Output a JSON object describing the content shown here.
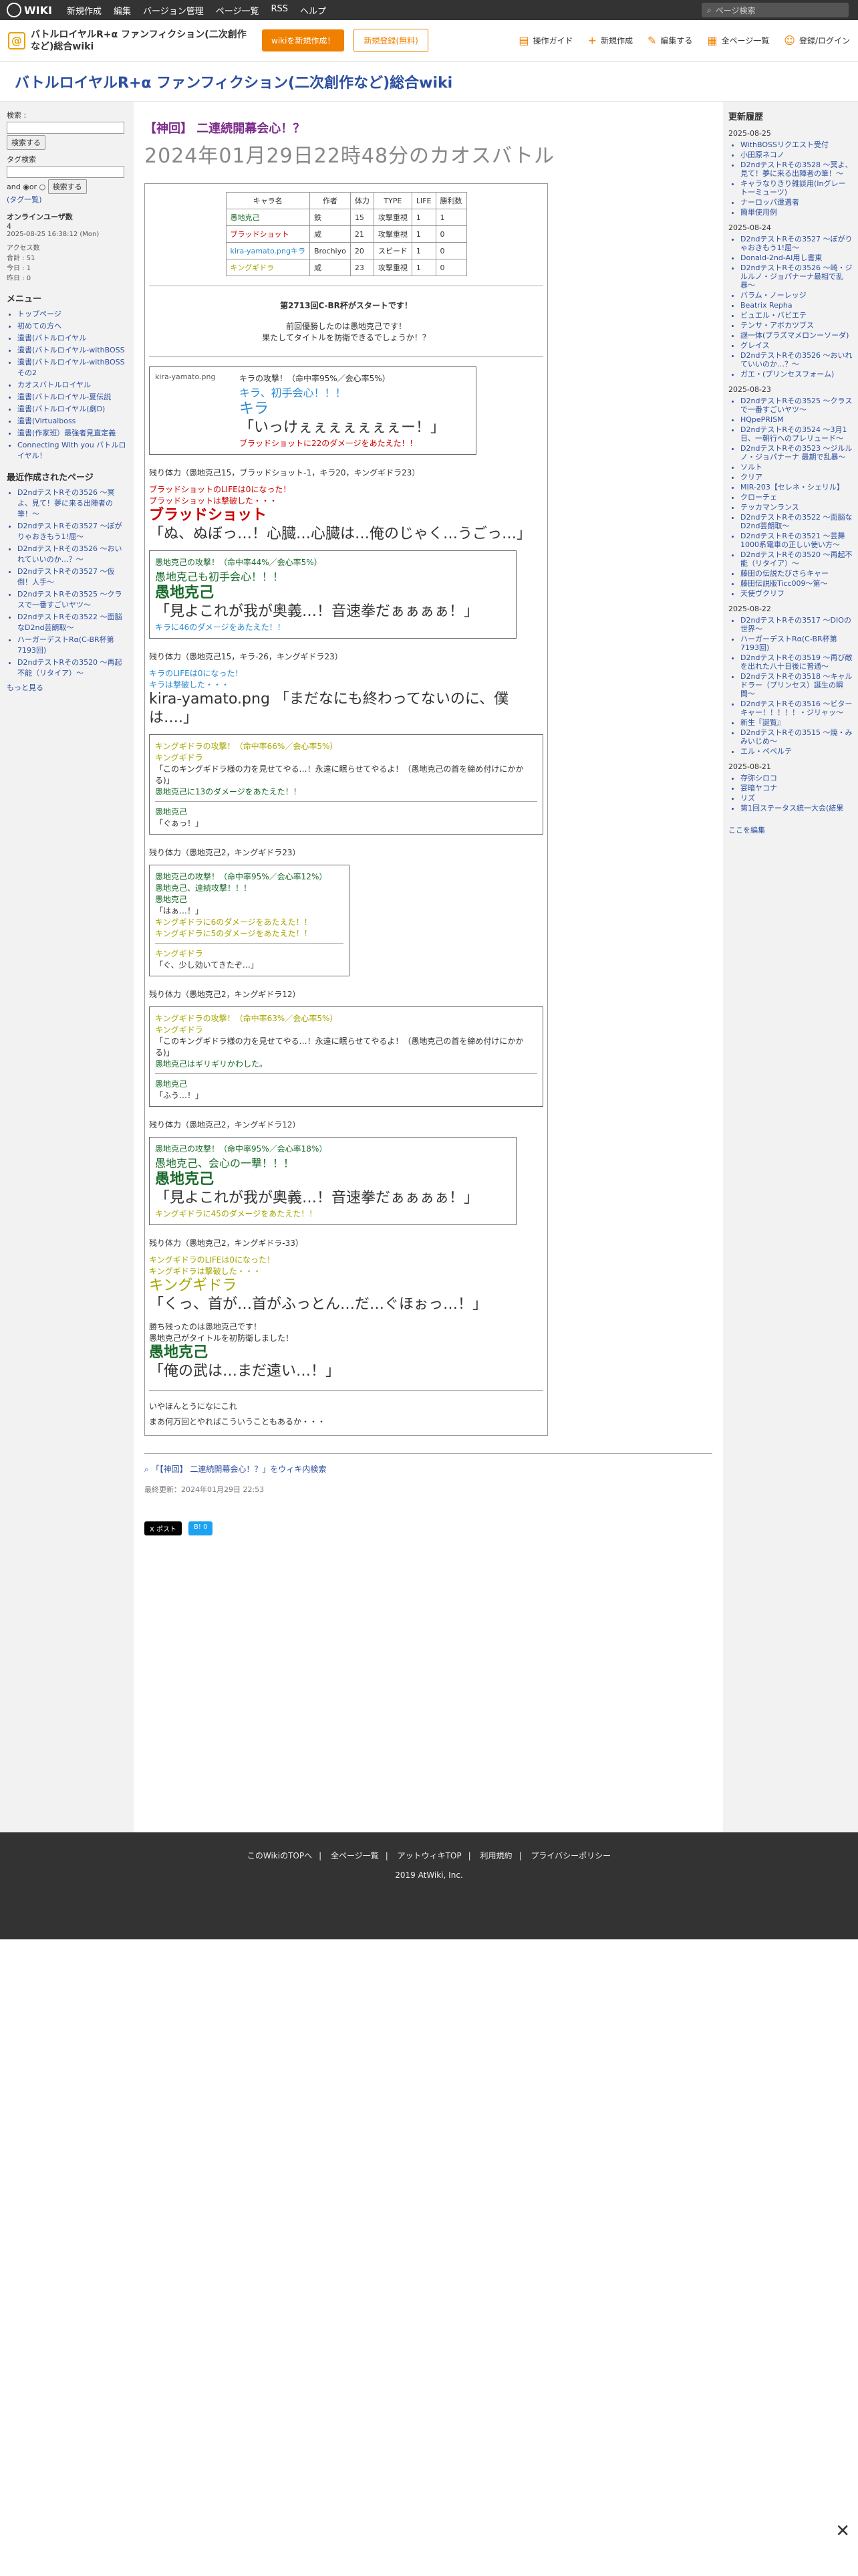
{
  "topbar": {
    "logo": "WIKI",
    "menu": [
      "新規作成",
      "編集",
      "バージョン管理",
      "ページ一覧",
      "RSS",
      "ヘルプ"
    ],
    "search_placeholder": "ページ検索"
  },
  "site": {
    "title_l1": "バトルロイヤルR+α ファンフィクション(二次創作",
    "title_l2": "など)総合wiki",
    "btn_new": "wikiを新規作成！",
    "btn_news": "新規登録(無料)",
    "tools": [
      "操作ガイド",
      "新規作成",
      "編集する",
      "全ページ一覧",
      "登録/ログイン"
    ]
  },
  "wiki_title": "バトルロイヤルR+α ファンフィクション(二次創作など)総合wiki",
  "left": {
    "search_label": "検索 :",
    "search_btn": "検索する",
    "tag_label": "タグ検索",
    "and": "and",
    "or": "or",
    "tag_btn": "検索する",
    "tag_list": "(タグ一覧)",
    "online_title": "オンラインユーザ数",
    "online_count": "4",
    "date": "2025-08-25 16:38:12 (Mon)",
    "access": "アクセス数",
    "total": "合計 : 51",
    "today": "今日 : 1",
    "yesterday": "昨日 : 0",
    "menu_title": "メニュー",
    "menu_items": [
      "トップページ",
      "初めての方へ",
      "遺書(バトルロイヤル",
      "遺書(バトルロイヤル-withBOSS",
      "遺書(バトルロイヤル-withBOSSその2",
      "カオスバトルロイヤル",
      "遺書(バトルロイヤル-夏伝説",
      "遺書(バトルロイヤル(劇D)",
      "遺書(Virtualboss",
      "遺書(作家班）最強者見直定義",
      "Connecting With you バトルロイヤル！"
    ],
    "recent_title": "最近作成されたページ",
    "recent": [
      "D2ndテストRその3526 〜冥よ、見て！夢に来る出陣者の筆！〜",
      "D2ndテストRその3527 〜ぼがりゃおきもう1!屈〜",
      "D2ndテストRその3526 〜おいれていいのか…？〜",
      "D2ndテストRその3527 〜仮倒！人手〜",
      "D2ndテストRその3525 〜クラスで一番すごいヤツ〜",
      "D2ndテストRその3522 〜面脳なD2nd芸朗取〜",
      "ハーガーデストRα(C-BR杯第7193回)",
      "D2ndテストRその3520 〜再起不能（リタイア）〜"
    ],
    "more": "もっと見る"
  },
  "page": {
    "head": "【神回】 二連続開幕会心！？",
    "sub": "2024年01月29日22時48分のカオスバトル"
  },
  "table": {
    "headers": [
      "キャラ名",
      "作者",
      "体力",
      "TYPE",
      "LIFE",
      "勝利数"
    ],
    "rows": [
      [
        "愚地克己",
        "鉄",
        "15",
        "攻撃重視",
        "1",
        "1"
      ],
      [
        "ブラッドショット",
        "咸",
        "21",
        "攻撃重視",
        "1",
        "0"
      ],
      [
        "kira-yamato.pngキラ",
        "Brochiyo",
        "20",
        "スピード",
        "1",
        "0"
      ],
      [
        "キングギドラ",
        "咸",
        "23",
        "攻撃重視",
        "1",
        "0"
      ]
    ]
  },
  "intro": {
    "l1": "第2713回C-BR杯がスタートです！",
    "l2": "前回優勝したのは愚地克己です！",
    "l3": "果たしてタイトルを防衛できるでしょうか！？"
  },
  "b1": {
    "img": "kira-yamato.png",
    "line": "キラの攻撃！（命中率95%／会心率5%）",
    "crit": "キラ、初手会心！！！",
    "name": "キラ",
    "quote": "「いっけぇぇぇぇぇぇぇー！」",
    "dmg": "ブラッドショットに22のダメージをあたえた！！"
  },
  "r1": "残り体力（愚地克己15，ブラッドショット-1，キラ20，キングギドラ23）",
  "d1": {
    "l1": "ブラッドショットのLIFEは0になった！",
    "l2": "ブラッドショットは撃破した・・・",
    "name": "ブラッドショット",
    "quote": "「ぬ、ぬぼっ…！心臓…心臓は…俺のじゃく…うごっ…」"
  },
  "b2": {
    "line": "愚地克己の攻撃！（命中率44%／会心率5%）",
    "crit": "愚地克己も初手会心！！！",
    "name": "愚地克己",
    "quote": "「見よこれが我が奥義…！音速拳だぁぁぁぁ！」",
    "dmg": "キラに46のダメージをあたえた！！"
  },
  "r2": "残り体力（愚地克己15，キラ-26，キングギドラ23）",
  "d2": {
    "l1": "キラのLIFEは0になった！",
    "l2": "キラは撃破した・・・",
    "img": "kira-yamato.png",
    "quote": "「まだなにも終わってないのに、僕は….」"
  },
  "b3": {
    "line": "キングギドラの攻撃！（命中率66%／会心率5%）",
    "name": "キングギドラ",
    "quote": "「このキングギドラ様の力を見せてやる…！永遠に眠らせてやるよ！（愚地克己の首を締め付けにかかる)」",
    "dmg": "愚地克己に13のダメージをあたえた！！",
    "name2": "愚地克己",
    "quote2": "「ぐぁっ！」"
  },
  "r3": "残り体力（愚地克己2，キングギドラ23）",
  "b4": {
    "line": "愚地克己の攻撃！（命中率95%／会心率12%）",
    "l2": "愚地克己、連続攻撃！！！",
    "l3": "愚地克己",
    "l4": "「はぁ…！」",
    "d1": "キングギドラに6のダメージをあたえた！！",
    "d2": "キングギドラに5のダメージをあたえた！！",
    "name": "キングギドラ",
    "quote": "「ぐ、少し効いてきたぞ…」"
  },
  "r4": "残り体力（愚地克己2，キングギドラ12）",
  "b5": {
    "line": "キングギドラの攻撃！（命中率63%／会心率5%）",
    "name": "キングギドラ",
    "quote": "「このキングギドラ様の力を見せてやる…！永遠に眠らせてやるよ！（愚地克己の首を締め付けにかかる)」",
    "l3": "愚地克己はギリギリかわした。",
    "name2": "愚地克己",
    "quote2": "「ふう…！」"
  },
  "r5": "残り体力（愚地克己2，キングギドラ12）",
  "b6": {
    "line": "愚地克己の攻撃！（命中率95%／会心率18%）",
    "crit": "愚地克己、会心の一撃！！！",
    "name": "愚地克己",
    "quote": "「見よこれが我が奥義…！音速拳だぁぁぁぁ！」",
    "dmg": "キングギドラに45のダメージをあたえた！！"
  },
  "r6": "残り体力（愚地克己2，キングギドラ-33）",
  "end": {
    "l1": "キングギドラのLIFEは0になった！",
    "l2": "キングギドラは撃破した・・・",
    "name": "キングギドラ",
    "quote": "「くっ、首が…首がふっとん…だ…ぐほぉっ…！」",
    "w1": "勝ち残ったのは愚地克己です！",
    "w2": "愚地克己がタイトルを初防衛しました！",
    "wname": "愚地克己",
    "wquote": "「俺の武は…まだ遠い…！」",
    "a1": "いやほんとうになにこれ",
    "a2": "まあ何万回とやればこういうこともあるか・・・"
  },
  "search_link": "「【神回】 二連続開幕会心！？」をウィキ内検索",
  "updated": "最終更新：2024年01月29日 22:53",
  "right": {
    "title": "更新履歴",
    "groups": [
      {
        "date": "2025-08-25",
        "items": [
          "WithBOSSリクエスト受付",
          "小田原ネコノ",
          "D2ndテストRその3528 〜冥よ、見て！夢に来る出陣者の筆！〜",
          "キャラなりきり雑談用(Inグレート一ミューツ)",
          "ナーロッパ遭遇者",
          "簡単使用例"
        ]
      },
      {
        "date": "2025-08-24",
        "items": [
          "D2ndテストRその3527 〜ぼがりゃおきもう1!屈〜",
          "Donald-2nd-AI用し書東",
          "D2ndテストRその3526 〜崎・ジルルノ・ジョパナーナ最相で乱暴〜",
          "バラム・ノーレッジ",
          "Beatrix Repha",
          "ビュエル・バビエテ",
          "テンサ・アボカツブス",
          "謎一体(プラズマメロンーソーダ)",
          "グレイス",
          "D2ndテストRその3526 〜おいれていいのか…？〜",
          "ガエ・(プリンセスフォーム)"
        ]
      },
      {
        "date": "2025-08-23",
        "items": [
          "D2ndテストRその3525 〜クラスで一番すごいヤツ〜",
          "HQpePRISM",
          "D2ndテストRその3524 〜3月1日、一朝行へのプレリュード〜",
          "D2ndテストRその3523 〜ジルルノ・ジョパナーナ 最期で乱暴〜",
          "ソルト",
          "クリア",
          "MIR-203【セレネ・シェリル】",
          "クローチェ",
          "テッカマンランス",
          "D2ndテストRその3522 〜面脳なD2nd芸朗取〜",
          "D2ndテストRその3521 〜芸舞1000系電車の正しい使い方〜",
          "D2ndテストRその3520 〜再起不能（リタイア）〜",
          "藤田の伝説たびさらキャー",
          "藤田伝説版Ticc009〜第〜",
          "天使ヴクリフ"
        ]
      },
      {
        "date": "2025-08-22",
        "items": [
          "D2ndテストRその3517 〜DIOの世界〜",
          "ハーガーデストRα(C-BR杯第7193回)",
          "D2ndテストRその3519 〜再び敵を出れた八十日後に普通〜",
          "D2ndテストRその3518 〜キャルドラー（プリンセス）誕生の瞬間〜",
          "D2ndテストRその3516 〜ビターキャー！！！！！・ジリャッ〜",
          "新生『誕覧』",
          "D2ndテストRその3515 〜焼・みみいじめ〜",
          "エル・ペペルテ"
        ]
      },
      {
        "date": "2025-08-21",
        "items": [
          "存弥シロコ",
          "宴暗ヤコナ",
          "リズ",
          "第1回ステータス統一大会(結果"
        ]
      }
    ],
    "more": "ここを編集"
  },
  "footer": {
    "links": [
      "このWikiのTOPへ",
      "全ページ一覧",
      "アットウィキTOP",
      "利用規約",
      "プライバシーポリシー"
    ],
    "copy": "2019 AtWiki, Inc."
  }
}
